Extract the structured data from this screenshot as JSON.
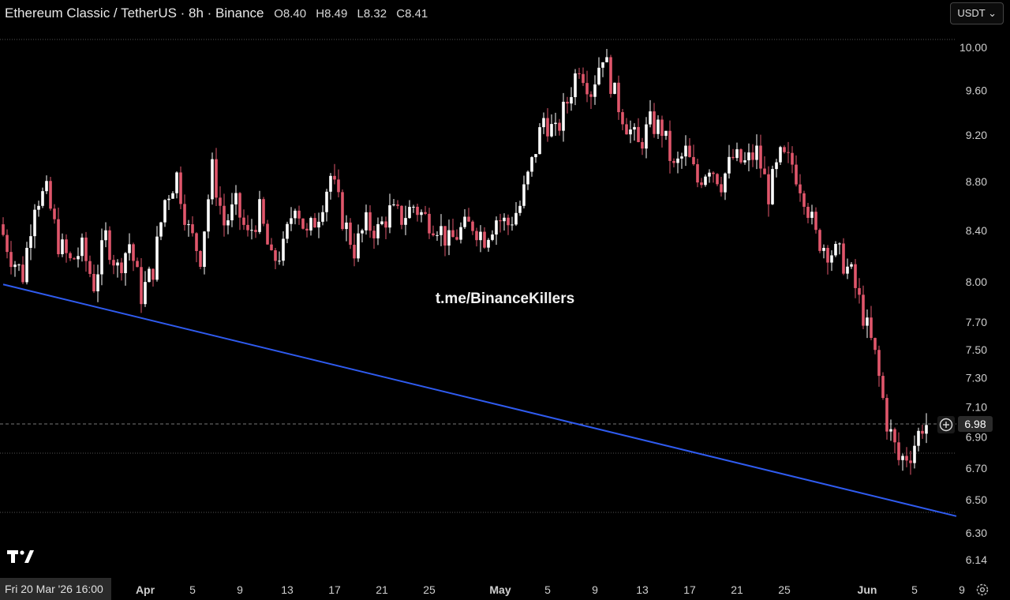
{
  "header": {
    "symbol": "Ethereum Classic / TetherUS · 8h · Binance",
    "open": "8.40",
    "high": "8.49",
    "low": "8.32",
    "close": "8.41",
    "open_key": "O",
    "high_key": "H",
    "low_key": "L",
    "close_key": "C"
  },
  "currency_button": "USDT",
  "watermark": "t.me/BinanceKillers",
  "crosshair_date": "Fri 20 Mar '26   16:00",
  "last_price": "6.98",
  "colors": {
    "up": "#ffffff",
    "down": "#e0566b",
    "trendline": "#2f5bef",
    "background": "#000000"
  },
  "icons": {
    "add": "plus-circle-icon",
    "settings": "gear-icon",
    "logo": "tradingview-logo"
  },
  "chart_data": {
    "type": "candlestick",
    "title": "Ethereum Classic / TetherUS · 8h · Binance",
    "y_axis_scale": "log",
    "y_ticks": [
      "10.00",
      "9.60",
      "9.20",
      "8.80",
      "8.40",
      "8.00",
      "7.70",
      "7.50",
      "7.30",
      "7.10",
      "6.90",
      "6.70",
      "6.50",
      "6.30",
      "6.14"
    ],
    "x_ticks": [
      "Apr",
      "5",
      "9",
      "13",
      "17",
      "21",
      "25",
      "May",
      "5",
      "9",
      "13",
      "17",
      "21",
      "25",
      "Jun",
      "5",
      "9"
    ],
    "ylim": [
      6.1,
      10.1
    ],
    "horizontal_levels": [
      10.05,
      6.98,
      6.8,
      6.47
    ],
    "trendline": {
      "start": {
        "date": "2026-03-20",
        "price": 7.98
      },
      "end": {
        "date": "2026-06-09",
        "price": 6.4
      }
    },
    "price_path": [
      [
        "2026-03-20",
        8.45
      ],
      [
        "2026-03-21",
        8.2
      ],
      [
        "2026-03-22",
        8.05
      ],
      [
        "2026-03-23",
        8.65
      ],
      [
        "2026-03-24",
        8.7
      ],
      [
        "2026-03-25",
        8.3
      ],
      [
        "2026-03-26",
        8.15
      ],
      [
        "2026-03-27",
        8.25
      ],
      [
        "2026-03-28",
        7.98
      ],
      [
        "2026-03-29",
        8.35
      ],
      [
        "2026-03-30",
        8.1
      ],
      [
        "2026-03-31",
        8.3
      ],
      [
        "2026-04-01",
        7.9
      ],
      [
        "2026-04-02",
        8.1
      ],
      [
        "2026-04-03",
        8.65
      ],
      [
        "2026-04-04",
        8.85
      ],
      [
        "2026-04-05",
        8.4
      ],
      [
        "2026-04-06",
        8.2
      ],
      [
        "2026-04-07",
        8.9
      ],
      [
        "2026-04-08",
        8.45
      ],
      [
        "2026-04-09",
        8.6
      ],
      [
        "2026-04-10",
        8.35
      ],
      [
        "2026-04-11",
        8.55
      ],
      [
        "2026-04-12",
        8.15
      ],
      [
        "2026-04-13",
        8.25
      ],
      [
        "2026-04-14",
        8.65
      ],
      [
        "2026-04-15",
        8.35
      ],
      [
        "2026-04-16",
        8.55
      ],
      [
        "2026-04-17",
        8.85
      ],
      [
        "2026-04-18",
        8.5
      ],
      [
        "2026-04-19",
        8.25
      ],
      [
        "2026-04-20",
        8.45
      ],
      [
        "2026-04-21",
        8.4
      ],
      [
        "2026-04-22",
        8.55
      ],
      [
        "2026-04-23",
        8.5
      ],
      [
        "2026-04-24",
        8.6
      ],
      [
        "2026-04-25",
        8.5
      ],
      [
        "2026-04-26",
        8.45
      ],
      [
        "2026-04-27",
        8.3
      ],
      [
        "2026-04-28",
        8.4
      ],
      [
        "2026-04-29",
        8.45
      ],
      [
        "2026-04-30",
        8.35
      ],
      [
        "2026-05-01",
        8.5
      ],
      [
        "2026-05-02",
        8.45
      ],
      [
        "2026-05-03",
        8.6
      ],
      [
        "2026-05-04",
        8.95
      ],
      [
        "2026-05-05",
        9.35
      ],
      [
        "2026-05-06",
        9.2
      ],
      [
        "2026-05-07",
        9.5
      ],
      [
        "2026-05-08",
        9.85
      ],
      [
        "2026-05-09",
        9.6
      ],
      [
        "2026-05-10",
        9.95
      ],
      [
        "2026-05-11",
        9.55
      ],
      [
        "2026-05-12",
        9.3
      ],
      [
        "2026-05-13",
        9.1
      ],
      [
        "2026-05-14",
        9.3
      ],
      [
        "2026-05-15",
        9.25
      ],
      [
        "2026-05-16",
        8.9
      ],
      [
        "2026-05-17",
        9.05
      ],
      [
        "2026-05-18",
        8.8
      ],
      [
        "2026-05-19",
        8.95
      ],
      [
        "2026-05-20",
        8.8
      ],
      [
        "2026-05-21",
        9.0
      ],
      [
        "2026-05-22",
        8.95
      ],
      [
        "2026-05-23",
        9.05
      ],
      [
        "2026-05-24",
        8.7
      ],
      [
        "2026-05-25",
        9.0
      ],
      [
        "2026-05-26",
        8.95
      ],
      [
        "2026-05-27",
        8.7
      ],
      [
        "2026-05-28",
        8.35
      ],
      [
        "2026-05-29",
        8.25
      ],
      [
        "2026-05-30",
        8.2
      ],
      [
        "2026-05-31",
        8.05
      ],
      [
        "2026-06-01",
        7.75
      ],
      [
        "2026-06-02",
        7.45
      ],
      [
        "2026-06-03",
        7.0
      ],
      [
        "2026-06-04",
        6.75
      ],
      [
        "2026-06-05",
        6.8
      ],
      [
        "2026-06-06",
        6.98
      ]
    ]
  }
}
